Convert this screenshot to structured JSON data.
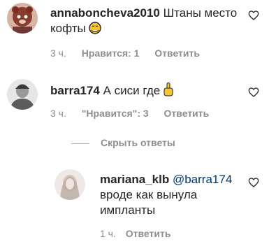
{
  "comments": [
    {
      "username": "annaboncheva2010",
      "text_line1": " Штаны место",
      "text_line2": "кофты",
      "time": "3 ч.",
      "likes": "Нравится: 1",
      "reply": "Ответить",
      "emoji_icon": "face-with-hand-over-mouth-emoji"
    },
    {
      "username": "barra174",
      "text": " А сиси где",
      "time": "3 ч.",
      "likes": "\"Нравится\": 3",
      "reply": "Ответить",
      "emoji_icon": "pointing-up-emoji"
    }
  ],
  "hide_replies_label": "Скрыть ответы",
  "reply_comment": {
    "username": "mariana_klb",
    "mention": "@barra174",
    "text_line2": "вроде как вынула",
    "text_line3": "импланты",
    "time": "1 ч.",
    "reply": "Ответить"
  },
  "colors": {
    "text": "#262626",
    "meta": "#8e8e8e",
    "mention": "#00376b"
  }
}
